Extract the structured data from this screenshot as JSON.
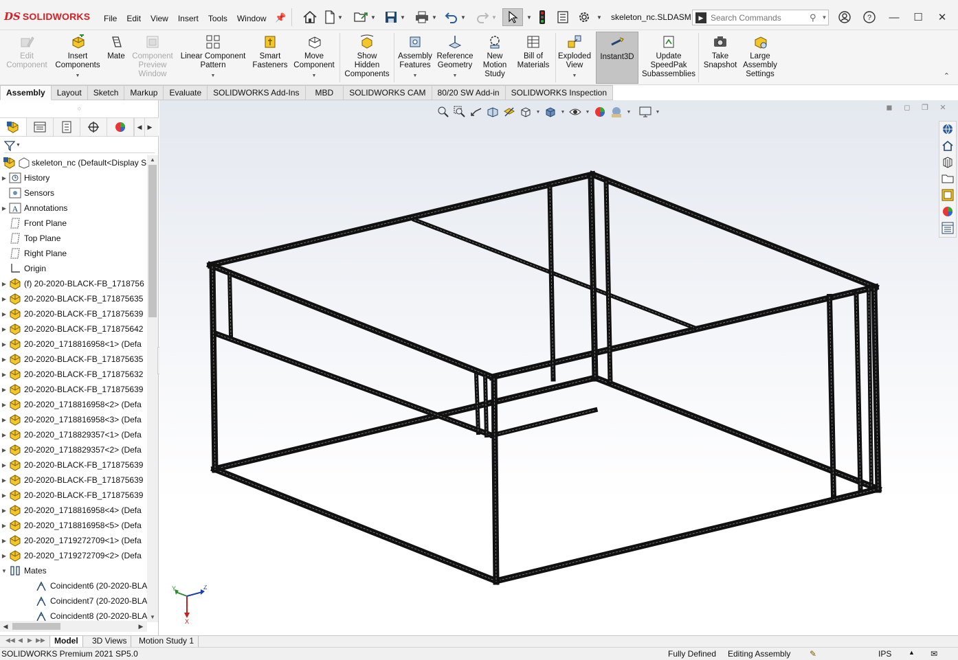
{
  "app": {
    "brand_ds": "DS",
    "brand_name": "SOLIDWORKS",
    "document_title": "skeleton_nc.SLDASM",
    "menu": [
      "File",
      "Edit",
      "View",
      "Insert",
      "Tools",
      "Window"
    ],
    "search_placeholder": "Search Commands"
  },
  "ribbon": {
    "buttons": [
      {
        "label": "Edit\nComponent",
        "icon": "edit-component-icon",
        "disabled": true
      },
      {
        "label": "Insert\nComponents",
        "icon": "insert-components-icon",
        "dropdown": true
      },
      {
        "label": "Mate",
        "icon": "mate-icon"
      },
      {
        "label": "Component\nPreview\nWindow",
        "icon": "component-preview-icon",
        "disabled": true
      },
      {
        "label": "Linear Component\nPattern",
        "icon": "linear-pattern-icon",
        "dropdown": true
      },
      {
        "label": "Smart\nFasteners",
        "icon": "smart-fasteners-icon"
      },
      {
        "label": "Move\nComponent",
        "icon": "move-component-icon",
        "dropdown": true
      },
      {
        "label": "Show\nHidden\nComponents",
        "icon": "show-hidden-icon"
      },
      {
        "label": "Assembly\nFeatures",
        "icon": "assembly-features-icon",
        "dropdown": true
      },
      {
        "label": "Reference\nGeometry",
        "icon": "reference-geometry-icon",
        "dropdown": true
      },
      {
        "label": "New\nMotion\nStudy",
        "icon": "motion-study-icon"
      },
      {
        "label": "Bill of\nMaterials",
        "icon": "bill-of-materials-icon"
      },
      {
        "label": "Exploded\nView",
        "icon": "exploded-view-icon",
        "dropdown": true
      },
      {
        "label": "Instant3D",
        "icon": "instant3d-icon",
        "active": true
      },
      {
        "label": "Update\nSpeedPak\nSubassemblies",
        "icon": "speedpak-icon"
      },
      {
        "label": "Take\nSnapshot",
        "icon": "snapshot-icon"
      },
      {
        "label": "Large\nAssembly\nSettings",
        "icon": "large-assembly-icon"
      }
    ]
  },
  "command_tabs": [
    "Assembly",
    "Layout",
    "Sketch",
    "Markup",
    "Evaluate",
    "SOLIDWORKS Add-Ins",
    "MBD",
    "SOLIDWORKS CAM",
    "80/20 SW Add-in",
    "SOLIDWORKS Inspection"
  ],
  "tree": {
    "root": "skeleton_nc  (Default<Display S",
    "items": [
      {
        "label": "History",
        "icon": "history-icon",
        "expander": true
      },
      {
        "label": "Sensors",
        "icon": "sensors-icon",
        "expander": false
      },
      {
        "label": "Annotations",
        "icon": "annotations-icon",
        "expander": true
      },
      {
        "label": "Front Plane",
        "icon": "plane-icon",
        "expander": false
      },
      {
        "label": "Top Plane",
        "icon": "plane-icon",
        "expander": false
      },
      {
        "label": "Right Plane",
        "icon": "plane-icon",
        "expander": false
      },
      {
        "label": "Origin",
        "icon": "origin-icon",
        "expander": false
      },
      {
        "label": "(f) 20-2020-BLACK-FB_1718756",
        "icon": "part-icon",
        "expander": true
      },
      {
        "label": "20-2020-BLACK-FB_171875635",
        "icon": "part-icon",
        "expander": true
      },
      {
        "label": "20-2020-BLACK-FB_171875639",
        "icon": "part-icon",
        "expander": true
      },
      {
        "label": "20-2020-BLACK-FB_171875642",
        "icon": "part-icon",
        "expander": true
      },
      {
        "label": "20-2020_1718816958<1> (Defa",
        "icon": "part-icon",
        "expander": true
      },
      {
        "label": "20-2020-BLACK-FB_171875635",
        "icon": "part-icon",
        "expander": true
      },
      {
        "label": "20-2020-BLACK-FB_171875632",
        "icon": "part-icon",
        "expander": true
      },
      {
        "label": "20-2020-BLACK-FB_171875639",
        "icon": "part-icon",
        "expander": true
      },
      {
        "label": "20-2020_1718816958<2> (Defa",
        "icon": "part-icon",
        "expander": true
      },
      {
        "label": "20-2020_1718816958<3> (Defa",
        "icon": "part-icon",
        "expander": true
      },
      {
        "label": "20-2020_1718829357<1> (Defa",
        "icon": "part-icon",
        "expander": true
      },
      {
        "label": "20-2020_1718829357<2> (Defa",
        "icon": "part-icon",
        "expander": true
      },
      {
        "label": "20-2020-BLACK-FB_171875639",
        "icon": "part-icon",
        "expander": true
      },
      {
        "label": "20-2020-BLACK-FB_171875639",
        "icon": "part-icon",
        "expander": true
      },
      {
        "label": "20-2020-BLACK-FB_171875639",
        "icon": "part-icon",
        "expander": true
      },
      {
        "label": "20-2020_1718816958<4> (Defa",
        "icon": "part-icon",
        "expander": true
      },
      {
        "label": "20-2020_1718816958<5> (Defa",
        "icon": "part-icon",
        "expander": true
      },
      {
        "label": "20-2020_1719272709<1> (Defa",
        "icon": "part-icon",
        "expander": true
      },
      {
        "label": "20-2020_1719272709<2> (Defa",
        "icon": "part-icon",
        "expander": true
      },
      {
        "label": "Mates",
        "icon": "mates-icon",
        "expander": true,
        "expanded": true
      },
      {
        "label": "Coincident6 (20-2020-BLA",
        "icon": "coincident-icon",
        "indent": true
      },
      {
        "label": "Coincident7 (20-2020-BLA",
        "icon": "coincident-icon",
        "indent": true
      },
      {
        "label": "Coincident8 (20-2020-BLA",
        "icon": "coincident-icon",
        "indent": true
      }
    ]
  },
  "triad": {
    "x": "X",
    "y": "Y",
    "z": "Z"
  },
  "bottom_tabs": [
    "Model",
    "3D Views",
    "Motion Study 1"
  ],
  "status": {
    "product": "SOLIDWORKS Premium 2021 SP5.0",
    "defined": "Fully Defined",
    "mode": "Editing Assembly",
    "units": "IPS"
  },
  "colors": {
    "brand": "#d61f26",
    "frame": "#111111",
    "frame_highlight": "#8a8a8a",
    "part_yellow": "#f3c62c"
  }
}
